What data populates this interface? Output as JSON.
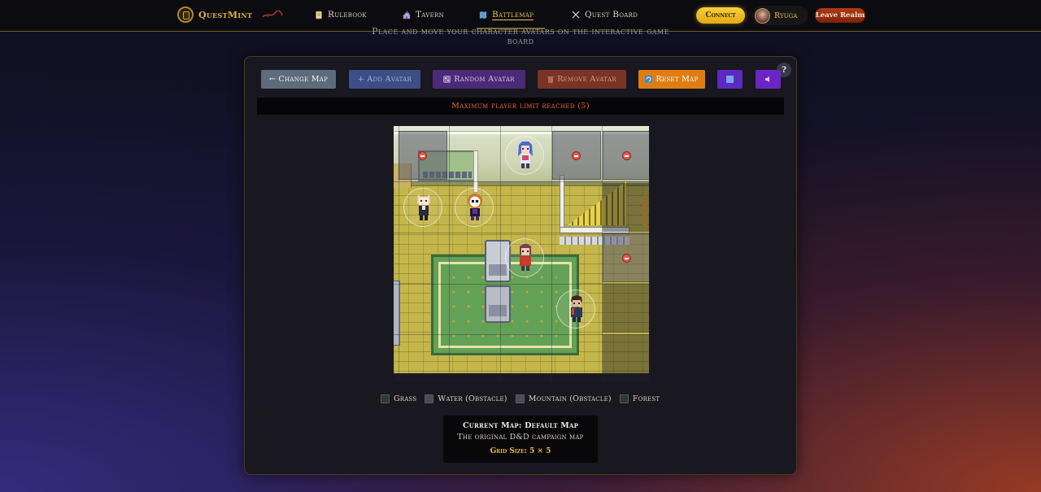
{
  "header": {
    "brand": "QuestMint",
    "nav": [
      {
        "label": "Rulebook",
        "icon": "scroll-icon"
      },
      {
        "label": "Tavern",
        "icon": "castle-icon"
      },
      {
        "label": "Battlemap",
        "icon": "map-icon"
      },
      {
        "label": "Quest Board",
        "icon": "crossed-swords-icon"
      }
    ],
    "active_nav": "Battlemap",
    "connect_label": "Connect",
    "username": "Ryuga",
    "leave_label": "Leave Realm"
  },
  "subtitle": "Place and move your character avatars on the interactive game board",
  "toolbar": {
    "change_map": "← Change Map",
    "add_avatar": "+ Add Avatar",
    "random_avatar": "Random Avatar",
    "remove_avatar": "Remove Avatar",
    "reset_map": "Reset Map",
    "help": "?"
  },
  "status": {
    "limit_message": "Maximum player limit reached (5)"
  },
  "legend": [
    {
      "label": "Grass",
      "color": "#2b3b2c"
    },
    {
      "label": "Water (Obstacle)",
      "color": "#4a4a58"
    },
    {
      "label": "Mountain (Obstacle)",
      "color": "#4c4c54"
    },
    {
      "label": "Forest",
      "color": "#2c3a2a"
    }
  ],
  "map_info": {
    "title": "Current Map: Default Map",
    "description": "The original D&D campaign map",
    "grid_size": "Grid Size: 5 × 5"
  },
  "colors": {
    "accent_gold": "#e8c056",
    "connect": "#f2c230",
    "leave": "#a2300f",
    "warning": "#e8652c"
  }
}
